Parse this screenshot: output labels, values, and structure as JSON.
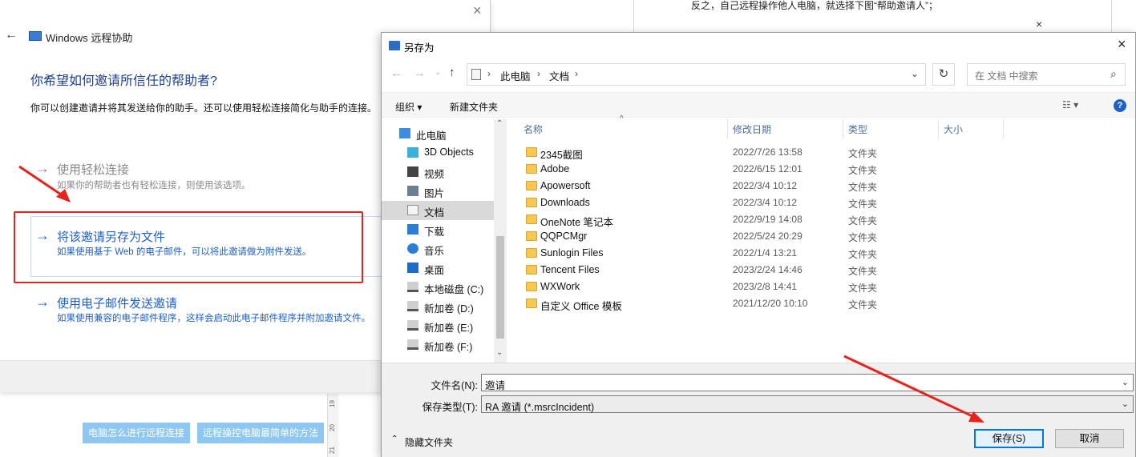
{
  "background_page": {
    "article_text": "反之，自己远程操作他人电脑，就选择下图“帮助邀请人”；",
    "close_glyph": "×",
    "ruler_numbers": [
      "19",
      "20",
      "21"
    ],
    "tag_buttons": [
      "电脑怎么进行远程连接",
      "远程操控电脑最简单的方法"
    ]
  },
  "remote_assistance": {
    "title": "Windows 远程协助",
    "heading": "你希望如何邀请所信任的帮助者?",
    "description": "你可以创建邀请并将其发送给你的助手。还可以使用轻松连接简化与助手的连接。",
    "options": [
      {
        "title": "使用轻松连接",
        "subtitle": "如果你的帮助者也有轻松连接，则使用该选项。",
        "enabled": false
      },
      {
        "title": "将该邀请另存为文件",
        "subtitle": "如果使用基于 Web 的电子邮件，可以将此邀请做为附件发送。",
        "enabled": true
      },
      {
        "title": "使用电子邮件发送邀请",
        "subtitle": "如果使用兼容的电子邮件程序，这样会启动此电子邮件程序并附加邀请文件。",
        "enabled": true
      }
    ],
    "arrow_glyph": "→",
    "back_glyph": "←",
    "close_glyph": "×"
  },
  "save_dialog": {
    "title": "另存为",
    "close_glyph": "×",
    "address": {
      "parts": [
        "此电脑",
        "文档"
      ],
      "separator": "›"
    },
    "search_placeholder": "在 文档 中搜索",
    "toolbar": {
      "organize": "组织 ▾",
      "new_folder": "新建文件夹",
      "view": "☷ ▾",
      "help": "?"
    },
    "nav_items": [
      {
        "label": "此电脑",
        "icon": "computer-icon",
        "color": "#3c8dde"
      },
      {
        "label": "3D Objects",
        "icon": "cube-icon",
        "color": "#3bb0d8"
      },
      {
        "label": "视频",
        "icon": "video-icon",
        "color": "#444444"
      },
      {
        "label": "图片",
        "icon": "picture-icon",
        "color": "#6d7f92"
      },
      {
        "label": "文档",
        "icon": "document-icon",
        "color": "#8f8f8f",
        "selected": true
      },
      {
        "label": "下载",
        "icon": "download-icon",
        "color": "#2a7fd4"
      },
      {
        "label": "音乐",
        "icon": "music-icon",
        "color": "#2a7fd4"
      },
      {
        "label": "桌面",
        "icon": "desktop-icon",
        "color": "#1f6cc6"
      },
      {
        "label": "本地磁盘 (C:)",
        "icon": "drive-icon",
        "color": "#555555"
      },
      {
        "label": "新加卷 (D:)",
        "icon": "drive-icon",
        "color": "#555555"
      },
      {
        "label": "新加卷 (E:)",
        "icon": "drive-icon",
        "color": "#555555"
      },
      {
        "label": "新加卷 (F:)",
        "icon": "drive-icon",
        "color": "#555555"
      }
    ],
    "columns": [
      "名称",
      "修改日期",
      "类型",
      "大小"
    ],
    "files": [
      {
        "name": "2345截图",
        "date": "2022/7/26 13:58",
        "type": "文件夹"
      },
      {
        "name": "Adobe",
        "date": "2022/6/15 12:01",
        "type": "文件夹"
      },
      {
        "name": "Apowersoft",
        "date": "2022/3/4 10:12",
        "type": "文件夹"
      },
      {
        "name": "Downloads",
        "date": "2022/3/4 10:12",
        "type": "文件夹"
      },
      {
        "name": "OneNote 笔记本",
        "date": "2022/9/19 14:08",
        "type": "文件夹"
      },
      {
        "name": "QQPCMgr",
        "date": "2022/5/24 20:29",
        "type": "文件夹"
      },
      {
        "name": "Sunlogin Files",
        "date": "2022/1/4 13:21",
        "type": "文件夹"
      },
      {
        "name": "Tencent Files",
        "date": "2023/2/24 14:46",
        "type": "文件夹"
      },
      {
        "name": "WXWork",
        "date": "2023/2/8 14:41",
        "type": "文件夹"
      },
      {
        "name": "自定义 Office 模板",
        "date": "2021/12/20 10:10",
        "type": "文件夹"
      }
    ],
    "filename_label": "文件名(N):",
    "filename_value": "邀请",
    "filetype_label": "保存类型(T):",
    "filetype_value": "RA 邀请 (*.msrcIncident)",
    "hide_folders": "隐藏文件夹",
    "save_button": "保存(S)",
    "cancel_button": "取消"
  },
  "annotation_color": "#e8231b"
}
